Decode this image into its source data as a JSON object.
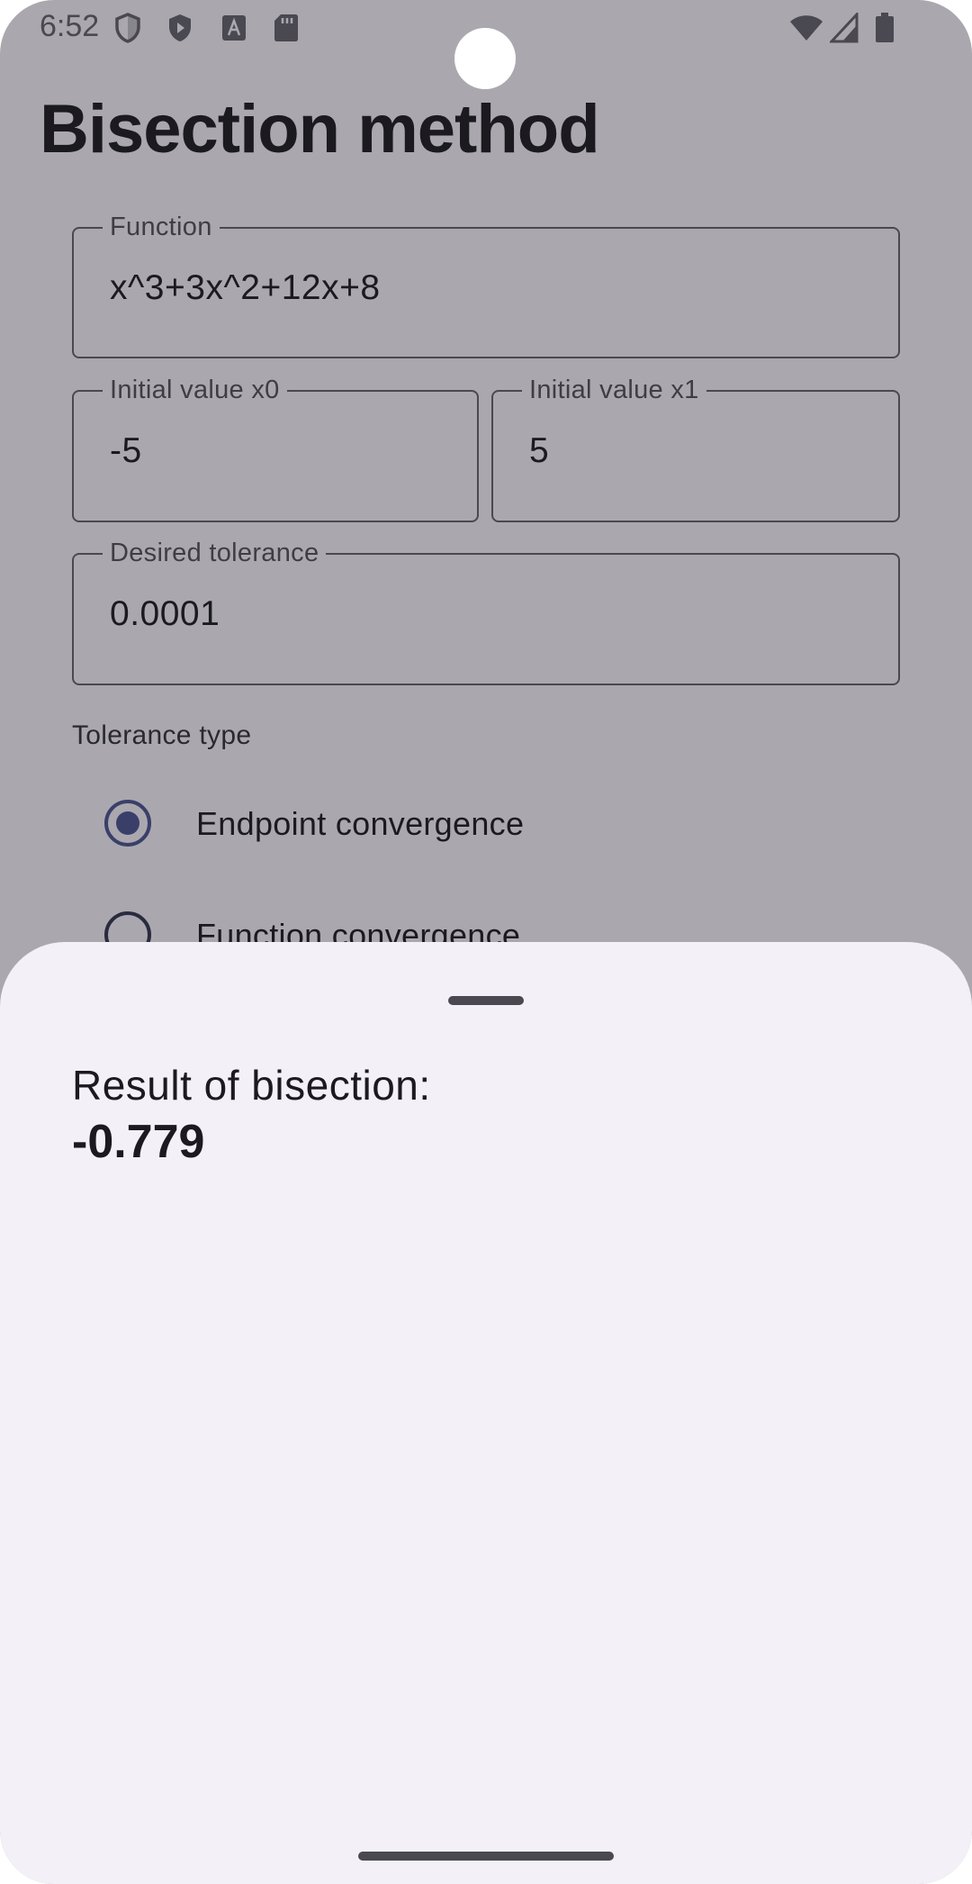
{
  "status_bar": {
    "time": "6:52",
    "left_icons": [
      "shield-outline-icon",
      "play-shield-icon",
      "text-a-icon",
      "sd-card-icon"
    ],
    "right_icons": [
      "wifi-icon",
      "cell-signal-icon",
      "battery-icon"
    ]
  },
  "page": {
    "title": "Bisection method"
  },
  "form": {
    "function": {
      "label": "Function",
      "value": "x^3+3x^2+12x+8"
    },
    "x0": {
      "label": "Initial value x0",
      "value": "-5"
    },
    "x1": {
      "label": "Initial value x1",
      "value": "5"
    },
    "tolerance": {
      "label": "Desired tolerance",
      "value": "0.0001"
    },
    "tolerance_type": {
      "label": "Tolerance type",
      "options": [
        {
          "label": "Endpoint convergence",
          "selected": true
        },
        {
          "label": "Function convergence",
          "selected": false
        }
      ]
    }
  },
  "sheet": {
    "result_label": "Result of bisection:",
    "result_value": "-0.779"
  },
  "colors": {
    "scrim": "#aaa8ae",
    "sheet_bg": "#f3f0f7",
    "radio_selected": "#3a3f6a",
    "text": "#1b1a1f"
  }
}
